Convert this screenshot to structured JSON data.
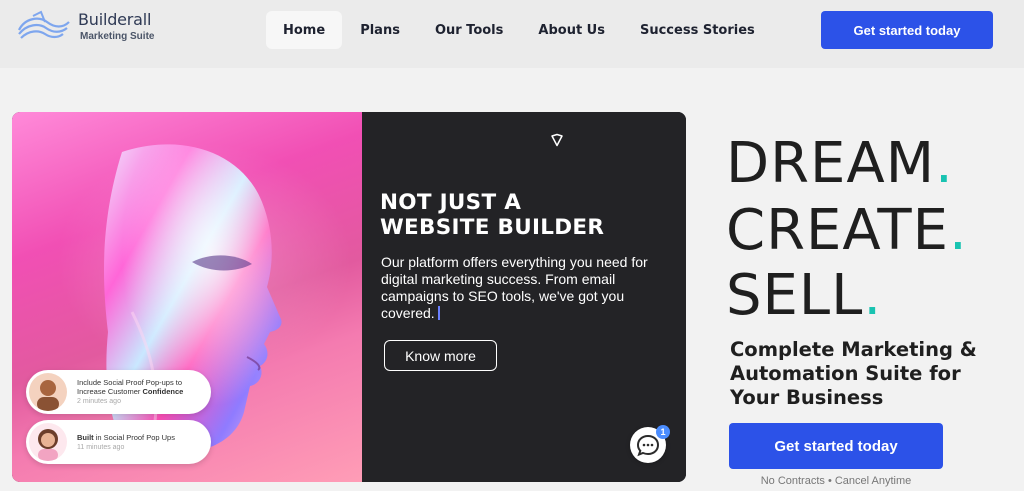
{
  "brand": {
    "name": "Builderall",
    "tagline": "Marketing Suite"
  },
  "nav": {
    "items": [
      {
        "label": "Home",
        "active": true
      },
      {
        "label": "Plans"
      },
      {
        "label": "Our Tools"
      },
      {
        "label": "About Us"
      },
      {
        "label": "Success Stories"
      }
    ],
    "cta_label": "Get started today"
  },
  "promo": {
    "headline_line1": "NOT JUST A",
    "headline_line2": "WEBSITE BUILDER",
    "body": "Our platform offers everything you need for digital marketing success. From email campaigns to SEO tools, we've got you covered.",
    "button_label": "Know more"
  },
  "social_proof": [
    {
      "pre": "Include Social Proof Pop-ups to Increase Customer ",
      "bold": "Confidence",
      "time": "2 minutes ago"
    },
    {
      "bold": "Built",
      "post": " in Social Proof Pop Ups",
      "time": "11 minutes ago"
    }
  ],
  "chat": {
    "badge_count": "1"
  },
  "hero": {
    "line1": "DREAM",
    "line2": "CREATE",
    "line3": "SELL",
    "dot": ".",
    "subtitle": "Complete Marketing & Automation Suite for Your Business",
    "cta_label": "Get started today",
    "note": "No Contracts • Cancel Anytime"
  },
  "colors": {
    "accent": "#2c52e8",
    "dot": "#19c3b1",
    "card_bg": "#232326",
    "badge": "#4b8dff"
  }
}
